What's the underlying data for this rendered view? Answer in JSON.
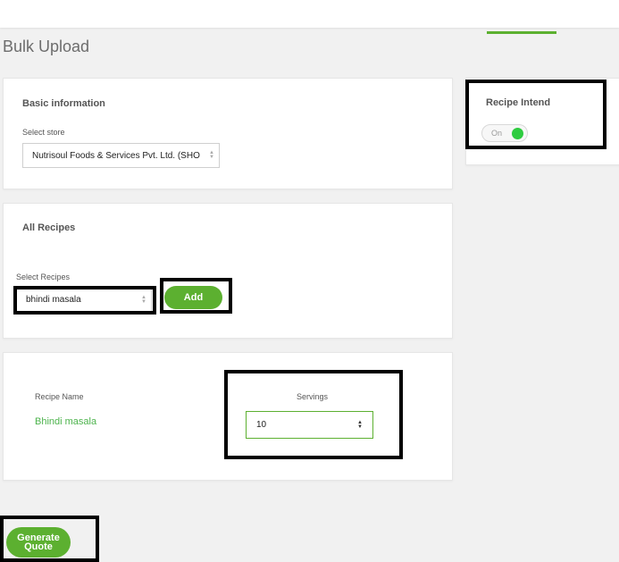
{
  "page": {
    "title": "Bulk Upload"
  },
  "basic_info": {
    "title": "Basic information",
    "store_label": "Select store",
    "store_value": "Nutrisoul Foods & Services Pvt. Ltd. (SHO"
  },
  "recipe_intend": {
    "title": "Recipe Intend",
    "toggle_label": "On",
    "toggle_on": true
  },
  "all_recipes": {
    "title": "All Recipes",
    "select_label": "Select Recipes",
    "select_value": "bhindi masala",
    "add_label": "Add"
  },
  "recipe_table": {
    "name_header": "Recipe Name",
    "servings_header": "Servings",
    "rows": [
      {
        "name": "Bhindi masala",
        "servings": "10"
      }
    ]
  },
  "actions": {
    "generate_line1": "Generate",
    "generate_line2": "Quote"
  },
  "colors": {
    "accent": "#5cb030",
    "toggle_on": "#2ecc40",
    "link": "#4cb34c",
    "highlight": "#000000"
  }
}
